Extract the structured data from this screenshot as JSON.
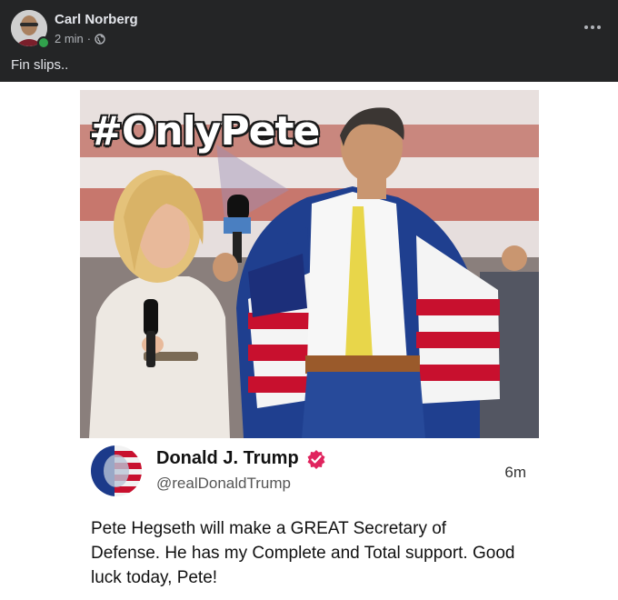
{
  "post": {
    "author": "Carl Norberg",
    "time": "2 min",
    "separator": "·",
    "text": "Fin slips..",
    "privacy_icon": "globe-icon",
    "more_icon": "more-horizontal-icon"
  },
  "image": {
    "hashtag": "#OnlyPete"
  },
  "tweet": {
    "name": "Donald J. Trump",
    "handle": "@realDonaldTrump",
    "time": "6m",
    "verified_icon": "verified-badge-icon",
    "body": "Pete Hegseth will make a GREAT Secretary of Defense. He has my Complete and Total support. Good luck today, Pete!"
  },
  "colors": {
    "header_bg": "#242526",
    "verified_badge": "#e0245e",
    "online_status": "#31a24c"
  }
}
